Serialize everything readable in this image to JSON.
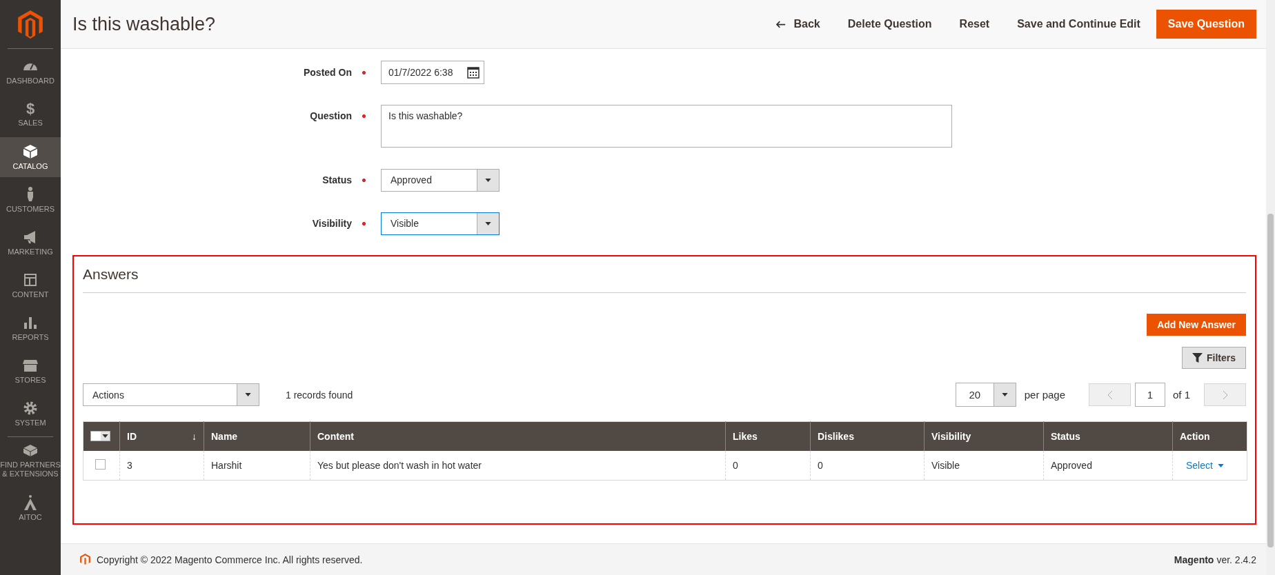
{
  "sidebar": {
    "items": [
      {
        "label": "DASHBOARD",
        "selected": false
      },
      {
        "label": "$",
        "kind": "glyph",
        "caption": "SALES",
        "selected": false
      },
      {
        "label": "CATALOG",
        "selected": true
      },
      {
        "label": "CUSTOMERS",
        "selected": false
      },
      {
        "label": "MARKETING",
        "selected": false
      },
      {
        "label": "CONTENT",
        "selected": false
      },
      {
        "label": "REPORTS",
        "selected": false
      },
      {
        "label": "STORES",
        "selected": false
      },
      {
        "label": "SYSTEM",
        "selected": false
      },
      {
        "label": "FIND PARTNERS & EXTENSIONS",
        "selected": false
      },
      {
        "label": "AITOC",
        "selected": false
      }
    ]
  },
  "header": {
    "title": "Is this washable?",
    "buttons": [
      {
        "label": "Back",
        "kind": "back"
      },
      {
        "label": "Delete Question",
        "kind": "plain"
      },
      {
        "label": "Reset",
        "kind": "plain"
      },
      {
        "label": "Save and Continue Edit",
        "kind": "plain"
      },
      {
        "label": "Save Question",
        "kind": "primary"
      }
    ]
  },
  "form": {
    "fields": [
      {
        "label": "Posted On",
        "required": true,
        "kind": "date",
        "value": "01/7/2022 6:38",
        "focused": false
      },
      {
        "label": "Question",
        "required": true,
        "kind": "textarea",
        "value": "Is this washable?",
        "focused": false
      },
      {
        "label": "Status",
        "required": true,
        "kind": "select",
        "value": "Approved",
        "focused": false
      },
      {
        "label": "Visibility",
        "required": true,
        "kind": "select",
        "value": "Visible",
        "focused": true
      }
    ]
  },
  "answers": {
    "title": "Answers",
    "add_button": "Add New Answer",
    "filters_button": "Filters",
    "actions": {
      "value": "Actions"
    },
    "records": "1 records found",
    "pager": {
      "per_page": "20",
      "per_page_label": "per page",
      "page": "1",
      "of": "of 1",
      "prev_disabled": true,
      "next_disabled": true
    },
    "table": {
      "select_all_checked": false,
      "columns": [
        {
          "label": "ID",
          "sort": "↓"
        },
        {
          "label": "Name"
        },
        {
          "label": "Content"
        },
        {
          "label": "Likes"
        },
        {
          "label": "Dislikes"
        },
        {
          "label": "Visibility"
        },
        {
          "label": "Status"
        },
        {
          "label": "Action"
        }
      ],
      "rows": [
        {
          "checked": false,
          "cells": [
            "3",
            "Harshit",
            "Yes but please don't wash in hot water",
            "0",
            "0",
            "Visible",
            "Approved"
          ],
          "action": "Select"
        }
      ]
    }
  },
  "footer": {
    "copyright": "Copyright © 2022 Magento Commerce Inc. All rights reserved.",
    "brand": "Magento",
    "version": "ver. 2.4.2"
  }
}
